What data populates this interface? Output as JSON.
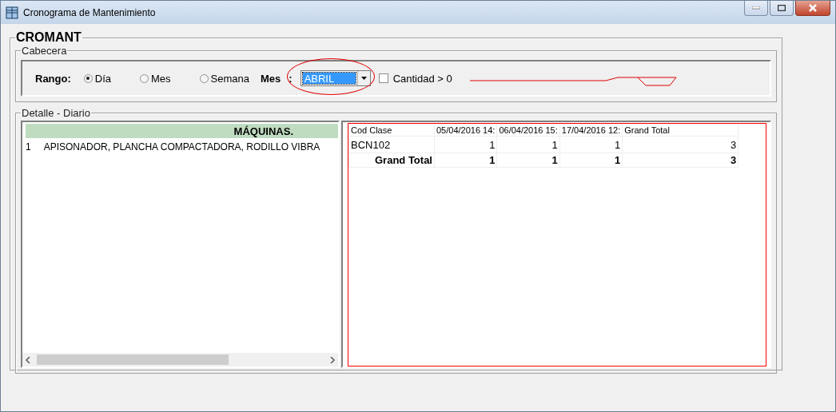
{
  "window": {
    "title": "Cronograma de Mantenimiento"
  },
  "group": {
    "title": "CROMANT"
  },
  "header": {
    "title": "Cabecera",
    "range_label": "Rango:",
    "radios": [
      {
        "label": "Día",
        "selected": true
      },
      {
        "label": "Mes",
        "selected": false
      },
      {
        "label": "Semana",
        "selected": false
      }
    ],
    "month_label": "Mes",
    "month_colon": ":",
    "month_value": "ABRIL",
    "quantity_check": {
      "label": "Cantidad > 0",
      "checked": false
    }
  },
  "detail": {
    "title": "Detalle - Diario",
    "list": {
      "header": "MÁQUINAS.",
      "rows": [
        {
          "index": "1",
          "name": "APISONADOR, PLANCHA COMPACTADORA, RODILLO VIBRA"
        }
      ]
    },
    "pivot": {
      "columns": [
        "Cod Clase",
        "05/04/2016 14:",
        "06/04/2016 15:",
        "17/04/2016 12:",
        "Grand Total"
      ],
      "rows": [
        {
          "kind": "data",
          "cells": [
            "BCN102",
            "1",
            "1",
            "1",
            "3"
          ]
        },
        {
          "kind": "total",
          "cells": [
            "Grand Total",
            "1",
            "1",
            "1",
            "3"
          ]
        }
      ]
    }
  }
}
